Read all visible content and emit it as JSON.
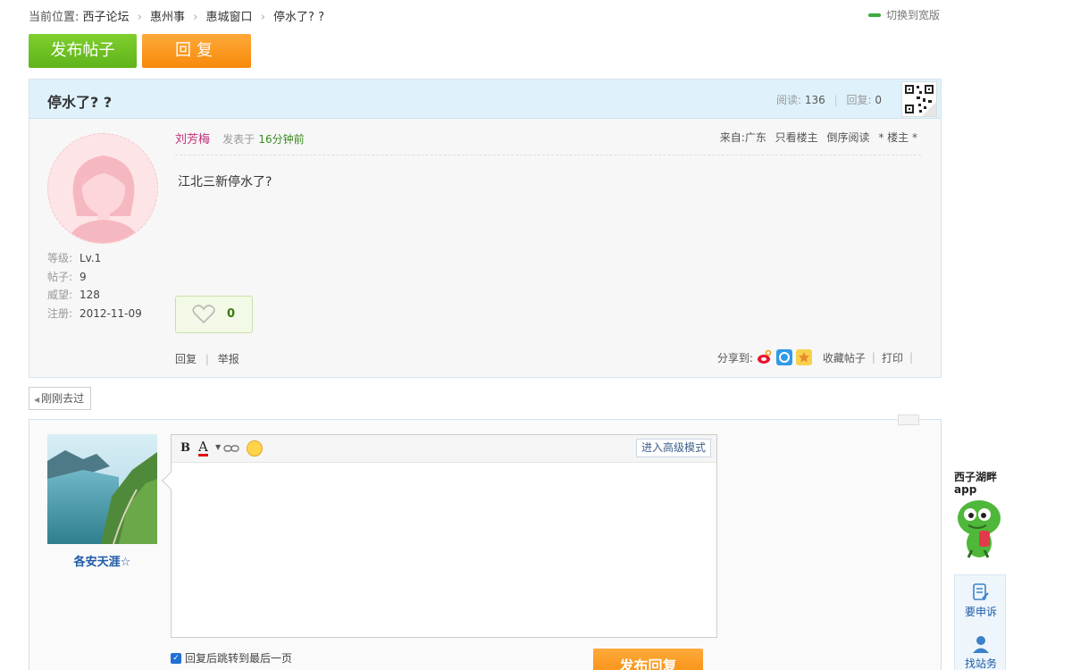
{
  "breadcrumb": {
    "prefix": "当前位置:",
    "items": [
      "西子论坛",
      "惠州事",
      "惠城窗口",
      "停水了? ?"
    ]
  },
  "wide_toggle": "切换到宽版",
  "toolbar": {
    "post_label": "发布帖子",
    "reply_label": "回复"
  },
  "thread": {
    "title": "停水了? ?",
    "read_label": "阅读:",
    "read_count": "136",
    "reply_label": "回复:",
    "reply_count": "0"
  },
  "author": {
    "level_label": "等级:",
    "level": "Lv.1",
    "posts_label": "帖子:",
    "posts": "9",
    "prestige_label": "威望:",
    "prestige": "128",
    "register_label": "注册:",
    "register_date": "2012-11-09"
  },
  "post": {
    "author_name": "刘芳梅",
    "posted_label": "发表于",
    "posted_time": "16分钟前",
    "from_label": "来自:广东",
    "only_owner": "只看楼主",
    "reverse_read": "倒序阅读",
    "floor": "* 楼主 *",
    "content": "江北三新停水了?",
    "like_count": "0",
    "reply_action": "回复",
    "report_action": "举报",
    "share_label": "分享到:",
    "favorite_action": "收藏帖子",
    "print_action": "打印"
  },
  "back_link": "刚刚去过",
  "reply_box": {
    "username": "各安天涯☆",
    "advanced_mode": "进入高级模式",
    "jump_checkbox": "回复后跳转到最后一页",
    "submit_label": "发布回复"
  },
  "sidebar": {
    "app_label": "西子湖畔 app",
    "complaint": "要申诉",
    "find_station": "找站务"
  },
  "colors": {
    "post_button": "#6cc124",
    "reply_button": "#f7930e",
    "header_bg": "#dff2fc",
    "author_name": "#c0307a"
  }
}
